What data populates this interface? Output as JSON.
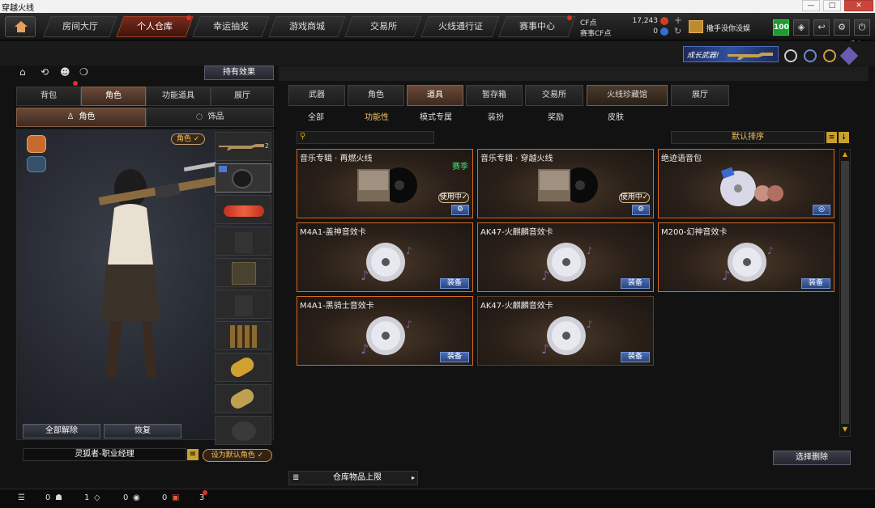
{
  "window": {
    "title": "穿越火线",
    "buttons": [
      "—",
      "□",
      "✕"
    ]
  },
  "topnav": {
    "tabs": [
      "房间大厅",
      "个人仓库",
      "幸运抽奖",
      "游戏商城",
      "交易所",
      "火线通行证",
      "赛事中心"
    ],
    "active_tab": "个人仓库",
    "cf_label": "CF点",
    "cf_value": "17,243",
    "match_cf_label": "赛事CF点",
    "match_cf_value": "0",
    "player_name": "撒手没你没娱",
    "level_badge": "100",
    "exit_tooltip": "退出"
  },
  "banner": {
    "text": "成长武器!"
  },
  "left": {
    "effects_button": "持有效果",
    "tabs": [
      "背包",
      "角色",
      "功能道具",
      "展厅"
    ],
    "active_tab": "角色",
    "subtabs": [
      "角色",
      "饰品"
    ],
    "role_badge": "角色 ✓",
    "unequip_all": "全部解除",
    "restore": "恢复",
    "character_name": "灵狐者-职业经理",
    "set_default": "设为默认角色 ✓",
    "weapon_slot_count": "2"
  },
  "right": {
    "tabs": [
      "武器",
      "角色",
      "道具",
      "暂存箱",
      "交易所",
      "火线珍藏馆",
      "展厅"
    ],
    "active_tab": "道具",
    "subtabs": [
      "全部",
      "功能性",
      "模式专属",
      "装扮",
      "奖励",
      "皮肤"
    ],
    "active_subtab": "功能性",
    "search_placeholder": "",
    "sort_label": "默认排序",
    "items": [
      {
        "name": "音乐专辑 · 再燃火线",
        "tag": "赛季",
        "status": "使用中✓",
        "action": "⚙",
        "type": "album"
      },
      {
        "name": "音乐专辑 · 穿越火线",
        "tag": "",
        "status": "使用中✓",
        "action": "⚙",
        "type": "album"
      },
      {
        "name": "绝迹语音包",
        "tag": "",
        "status": "",
        "action": "◎",
        "type": "voice"
      },
      {
        "name": "M4A1-盖神音效卡",
        "tag": "",
        "status": "",
        "action": "装备",
        "type": "disc"
      },
      {
        "name": "AK47-火麒麟音效卡",
        "tag": "",
        "status": "",
        "action": "装备",
        "type": "disc"
      },
      {
        "name": "M200-幻神音效卡",
        "tag": "",
        "status": "",
        "action": "装备",
        "type": "disc"
      },
      {
        "name": "M4A1-黑骑士音效卡",
        "tag": "",
        "status": "",
        "action": "装备",
        "type": "disc"
      },
      {
        "name": "AK47-火麒麟音效卡",
        "tag": "",
        "status": "",
        "action": "装备",
        "type": "disc"
      }
    ],
    "select_delete": "选择删除",
    "capacity_label": "仓库物品上限"
  },
  "bottombar": {
    "counts": [
      "0",
      "1",
      "0",
      "0",
      "3"
    ]
  },
  "colors": {
    "accent_orange": "#d86a20",
    "equip_blue": "#3a5aa0",
    "tag_green": "#40e070"
  }
}
